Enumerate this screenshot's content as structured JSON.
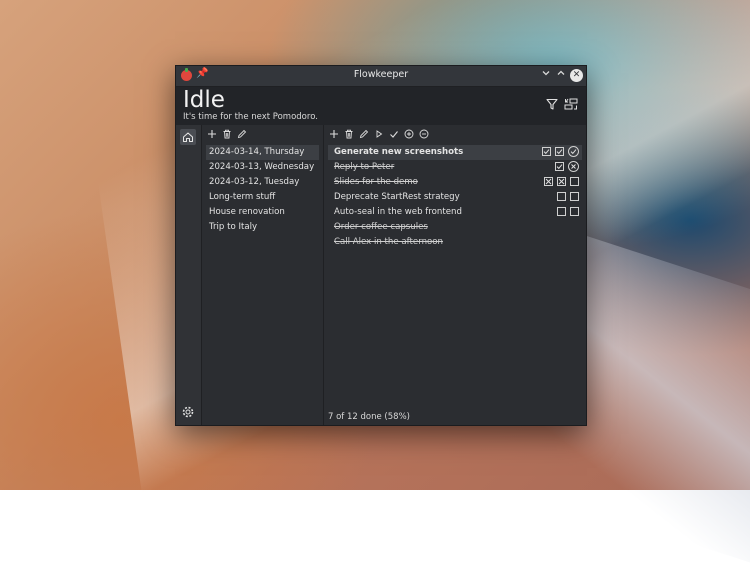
{
  "window": {
    "title": "Flowkeeper"
  },
  "titlebar_icons": [
    "tomato-app-icon",
    "pin-icon",
    "chevron-down-icon",
    "chevron-up-icon",
    "close-icon"
  ],
  "header": {
    "state": "Idle",
    "subtitle": "It's time for the next Pomodoro.",
    "icons": [
      "filter-icon",
      "connect-icon"
    ]
  },
  "sidebar": {
    "icons": [
      "home-icon",
      "gear-icon"
    ]
  },
  "backlogs": {
    "toolbar": [
      "add-icon",
      "delete-icon",
      "edit-icon"
    ],
    "items": [
      {
        "label": "2024-03-14, Thursday",
        "selected": true
      },
      {
        "label": "2024-03-13, Wednesday",
        "selected": false
      },
      {
        "label": "2024-03-12, Tuesday",
        "selected": false
      },
      {
        "label": "Long-term stuff",
        "selected": false
      },
      {
        "label": "House renovation",
        "selected": false
      },
      {
        "label": "Trip to Italy",
        "selected": false
      }
    ]
  },
  "tasks": {
    "toolbar": [
      "add-icon",
      "delete-icon",
      "edit-icon",
      "start-icon",
      "complete-icon",
      "add-pomodoro-icon",
      "remove-pomodoro-icon"
    ],
    "items": [
      {
        "label": "Generate new screenshots",
        "done": false,
        "selected": true,
        "marks": [
          "checked",
          "checked",
          "circle-check"
        ]
      },
      {
        "label": "Reply to Peter",
        "done": true,
        "selected": false,
        "marks": [
          "checked",
          "circle-x"
        ]
      },
      {
        "label": "Slides for the demo",
        "done": true,
        "selected": false,
        "marks": [
          "x",
          "x",
          "empty"
        ]
      },
      {
        "label": "Deprecate StartRest strategy",
        "done": false,
        "selected": false,
        "marks": [
          "empty",
          "empty"
        ]
      },
      {
        "label": "Auto-seal in the web frontend",
        "done": false,
        "selected": false,
        "marks": [
          "empty",
          "empty"
        ]
      },
      {
        "label": "Order coffee capsules",
        "done": true,
        "selected": false,
        "marks": []
      },
      {
        "label": "Call Alex in the afternoon",
        "done": true,
        "selected": false,
        "marks": []
      }
    ]
  },
  "status": {
    "text": "7 of 12 done (58%)"
  },
  "colors": {
    "window_bg": "#2b2d31",
    "header_bg": "#222428",
    "selection": "#3c3f44",
    "app_icon": "#e0473d"
  }
}
